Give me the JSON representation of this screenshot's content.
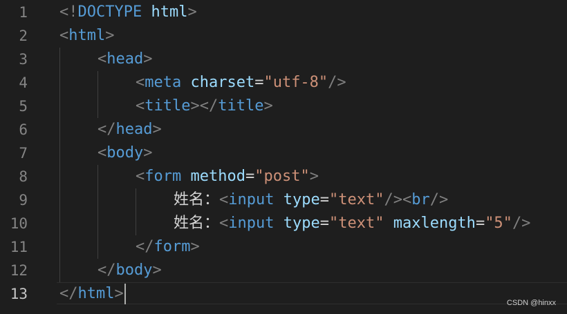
{
  "colors": {
    "background": "#1e1e1e",
    "punctuation": "#808080",
    "tag": "#569cd6",
    "attribute": "#9cdcfe",
    "string": "#ce9178",
    "text": "#d4d4d4",
    "line_number": "#858585"
  },
  "current_line": 13,
  "lines": [
    {
      "number": "1",
      "indent": 0,
      "tokens": [
        {
          "t": "p",
          "v": "<!"
        },
        {
          "t": "g",
          "v": "DOCTYPE"
        },
        {
          "t": "x",
          "v": " "
        },
        {
          "t": "a",
          "v": "html"
        },
        {
          "t": "p",
          "v": ">"
        }
      ]
    },
    {
      "number": "2",
      "indent": 0,
      "tokens": [
        {
          "t": "p",
          "v": "<"
        },
        {
          "t": "k",
          "v": "html"
        },
        {
          "t": "p",
          "v": ">"
        }
      ]
    },
    {
      "number": "3",
      "indent": 1,
      "tokens": [
        {
          "t": "p",
          "v": "<"
        },
        {
          "t": "k",
          "v": "head"
        },
        {
          "t": "p",
          "v": ">"
        }
      ]
    },
    {
      "number": "4",
      "indent": 2,
      "tokens": [
        {
          "t": "p",
          "v": "<"
        },
        {
          "t": "k",
          "v": "meta"
        },
        {
          "t": "x",
          "v": " "
        },
        {
          "t": "a",
          "v": "charset"
        },
        {
          "t": "x",
          "v": "="
        },
        {
          "t": "s",
          "v": "\"utf-8\""
        },
        {
          "t": "p",
          "v": "/>"
        }
      ]
    },
    {
      "number": "5",
      "indent": 2,
      "tokens": [
        {
          "t": "p",
          "v": "<"
        },
        {
          "t": "k",
          "v": "title"
        },
        {
          "t": "p",
          "v": "></"
        },
        {
          "t": "k",
          "v": "title"
        },
        {
          "t": "p",
          "v": ">"
        }
      ]
    },
    {
      "number": "6",
      "indent": 1,
      "tokens": [
        {
          "t": "p",
          "v": "</"
        },
        {
          "t": "k",
          "v": "head"
        },
        {
          "t": "p",
          "v": ">"
        }
      ]
    },
    {
      "number": "7",
      "indent": 1,
      "tokens": [
        {
          "t": "p",
          "v": "<"
        },
        {
          "t": "k",
          "v": "body"
        },
        {
          "t": "p",
          "v": ">"
        }
      ]
    },
    {
      "number": "8",
      "indent": 2,
      "tokens": [
        {
          "t": "p",
          "v": "<"
        },
        {
          "t": "k",
          "v": "form"
        },
        {
          "t": "x",
          "v": " "
        },
        {
          "t": "a",
          "v": "method"
        },
        {
          "t": "x",
          "v": "="
        },
        {
          "t": "s",
          "v": "\"post\""
        },
        {
          "t": "p",
          "v": ">"
        }
      ]
    },
    {
      "number": "9",
      "indent": 3,
      "tokens": [
        {
          "t": "x",
          "v": "姓名："
        },
        {
          "t": "p",
          "v": "<"
        },
        {
          "t": "k",
          "v": "input"
        },
        {
          "t": "x",
          "v": " "
        },
        {
          "t": "a",
          "v": "type"
        },
        {
          "t": "x",
          "v": "="
        },
        {
          "t": "s",
          "v": "\"text\""
        },
        {
          "t": "p",
          "v": "/><"
        },
        {
          "t": "k",
          "v": "br"
        },
        {
          "t": "p",
          "v": "/>"
        }
      ]
    },
    {
      "number": "10",
      "indent": 3,
      "tokens": [
        {
          "t": "x",
          "v": "姓名："
        },
        {
          "t": "p",
          "v": "<"
        },
        {
          "t": "k",
          "v": "input"
        },
        {
          "t": "x",
          "v": " "
        },
        {
          "t": "a",
          "v": "type"
        },
        {
          "t": "x",
          "v": "="
        },
        {
          "t": "s",
          "v": "\"text\""
        },
        {
          "t": "x",
          "v": " "
        },
        {
          "t": "a",
          "v": "maxlength"
        },
        {
          "t": "x",
          "v": "="
        },
        {
          "t": "s",
          "v": "\"5\""
        },
        {
          "t": "p",
          "v": "/>"
        }
      ]
    },
    {
      "number": "11",
      "indent": 2,
      "tokens": [
        {
          "t": "p",
          "v": "</"
        },
        {
          "t": "k",
          "v": "form"
        },
        {
          "t": "p",
          "v": ">"
        }
      ]
    },
    {
      "number": "12",
      "indent": 1,
      "tokens": [
        {
          "t": "p",
          "v": "</"
        },
        {
          "t": "k",
          "v": "body"
        },
        {
          "t": "p",
          "v": ">"
        }
      ]
    },
    {
      "number": "13",
      "indent": 0,
      "tokens": [
        {
          "t": "p",
          "v": "</"
        },
        {
          "t": "k",
          "v": "html"
        },
        {
          "t": "p",
          "v": ">"
        }
      ]
    }
  ],
  "watermark": "CSDN @hinxx"
}
